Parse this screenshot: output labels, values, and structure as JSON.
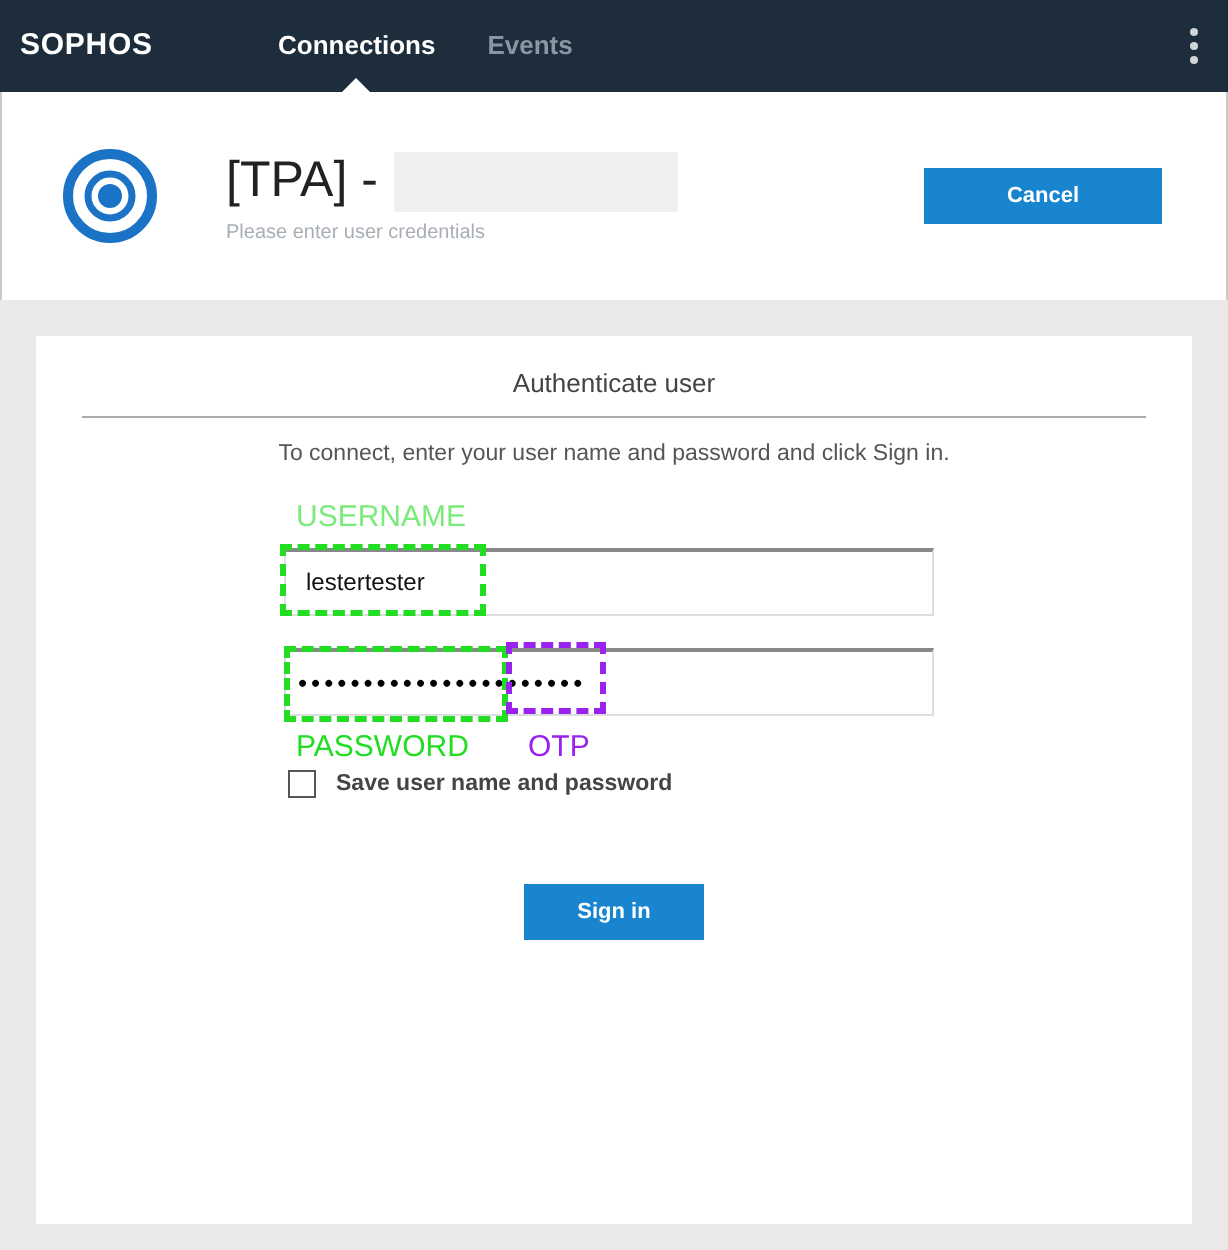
{
  "navbar": {
    "logo": "SOPHOS",
    "tabs": [
      {
        "label": "Connections",
        "selected": true
      },
      {
        "label": "Events",
        "selected": false
      }
    ]
  },
  "header": {
    "title": "[TPA] -",
    "subtitle": "Please enter user credentials",
    "cancel_button": "Cancel"
  },
  "form": {
    "title": "Authenticate user",
    "instructions": "To connect, enter your user name and password and click Sign in.",
    "username": {
      "value": "lestertester"
    },
    "password": {
      "value": "••••••••••••••••••••••"
    },
    "save_credentials": {
      "label": "Save user name and password",
      "checked": false
    },
    "sign_in_button": "Sign in"
  },
  "annotations": [
    {
      "label": "USERNAME",
      "color": "#22dd22"
    },
    {
      "label": "PASSWORD",
      "color": "#22dd22"
    },
    {
      "label": "OTP",
      "color": "#9922ee"
    }
  ]
}
